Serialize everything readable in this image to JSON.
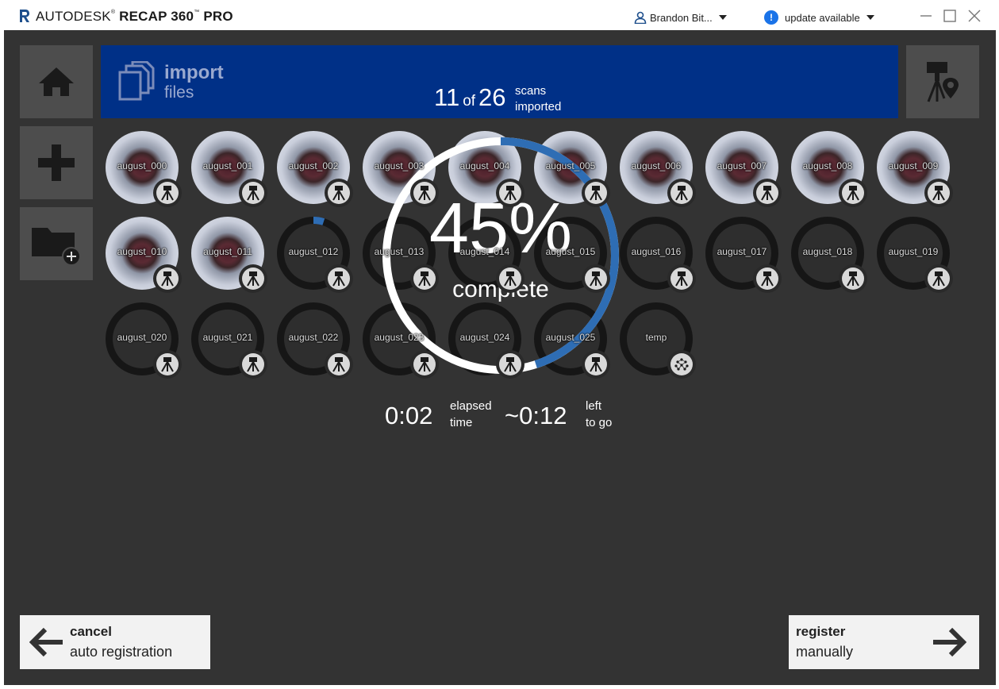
{
  "window": {
    "brand": "AUTODESK",
    "product": "RECAP 360",
    "edition": "PRO",
    "user_name": "Brandon Bit...",
    "update_label": "update available"
  },
  "banner": {
    "title": "import",
    "subtitle": "files",
    "imported_count": "11",
    "of_label": "of",
    "total_count": "26",
    "scans_label": "scans",
    "imported_label": "imported"
  },
  "progress": {
    "percent_text": "45%",
    "percent_value": 45,
    "complete_label": "complete",
    "elapsed_value": "0:02",
    "elapsed_label_1": "elapsed",
    "elapsed_label_2": "time",
    "left_value": "~0:12",
    "left_label_1": "left",
    "left_label_2": "to go"
  },
  "scans": [
    {
      "name": "august_000",
      "state": "imported",
      "icon": "tripod-icon"
    },
    {
      "name": "august_001",
      "state": "imported",
      "icon": "tripod-icon"
    },
    {
      "name": "august_002",
      "state": "imported",
      "icon": "tripod-icon"
    },
    {
      "name": "august_003",
      "state": "imported",
      "icon": "tripod-icon"
    },
    {
      "name": "august_004",
      "state": "imported",
      "icon": "tripod-icon"
    },
    {
      "name": "august_005",
      "state": "imported",
      "icon": "tripod-icon"
    },
    {
      "name": "august_006",
      "state": "imported",
      "icon": "tripod-icon"
    },
    {
      "name": "august_007",
      "state": "imported",
      "icon": "tripod-icon"
    },
    {
      "name": "august_008",
      "state": "imported",
      "icon": "tripod-icon"
    },
    {
      "name": "august_009",
      "state": "imported",
      "icon": "tripod-icon"
    },
    {
      "name": "august_010",
      "state": "imported",
      "icon": "tripod-icon"
    },
    {
      "name": "august_011",
      "state": "imported",
      "icon": "tripod-icon"
    },
    {
      "name": "august_012",
      "state": "importing",
      "progress": 0.05,
      "icon": "tripod-icon"
    },
    {
      "name": "august_013",
      "state": "pending",
      "icon": "tripod-icon"
    },
    {
      "name": "august_014",
      "state": "pending",
      "icon": "tripod-icon"
    },
    {
      "name": "august_015",
      "state": "pending",
      "icon": "tripod-icon"
    },
    {
      "name": "august_016",
      "state": "pending",
      "icon": "tripod-icon"
    },
    {
      "name": "august_017",
      "state": "pending",
      "icon": "tripod-icon"
    },
    {
      "name": "august_018",
      "state": "pending",
      "icon": "tripod-icon"
    },
    {
      "name": "august_019",
      "state": "pending",
      "icon": "tripod-icon"
    },
    {
      "name": "august_020",
      "state": "pending",
      "icon": "tripod-icon"
    },
    {
      "name": "august_021",
      "state": "pending",
      "icon": "tripod-icon"
    },
    {
      "name": "august_022",
      "state": "pending",
      "icon": "tripod-icon"
    },
    {
      "name": "august_023",
      "state": "pending",
      "icon": "tripod-icon"
    },
    {
      "name": "august_024",
      "state": "pending",
      "icon": "tripod-icon"
    },
    {
      "name": "august_025",
      "state": "pending",
      "icon": "tripod-icon"
    },
    {
      "name": "temp",
      "state": "pending",
      "icon": "point-cloud-icon"
    }
  ],
  "buttons": {
    "cancel_title": "cancel",
    "cancel_sub": "auto registration",
    "register_title": "register",
    "register_sub": "manually"
  },
  "colors": {
    "banner": "#003087",
    "progress_accent": "#2e6db4",
    "background": "#333333"
  }
}
